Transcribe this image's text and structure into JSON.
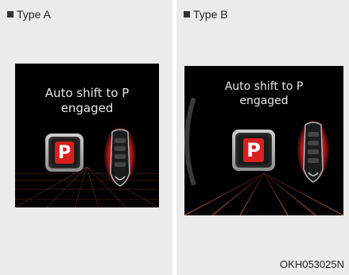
{
  "panel_a": {
    "heading": "Type A",
    "message_line1": "Auto shift to P",
    "message_line2": "engaged",
    "indicator_letter": "P"
  },
  "panel_b": {
    "heading": "Type B",
    "message_line1": "Auto shift to P",
    "message_line2": "engaged",
    "indicator_letter": "P"
  },
  "caption": "OKH053025N",
  "colors": {
    "panel_background": "#ebebeb",
    "screen_background": "#000000",
    "indicator_red": "#d8201f",
    "grid_glow": "#c8552a"
  }
}
